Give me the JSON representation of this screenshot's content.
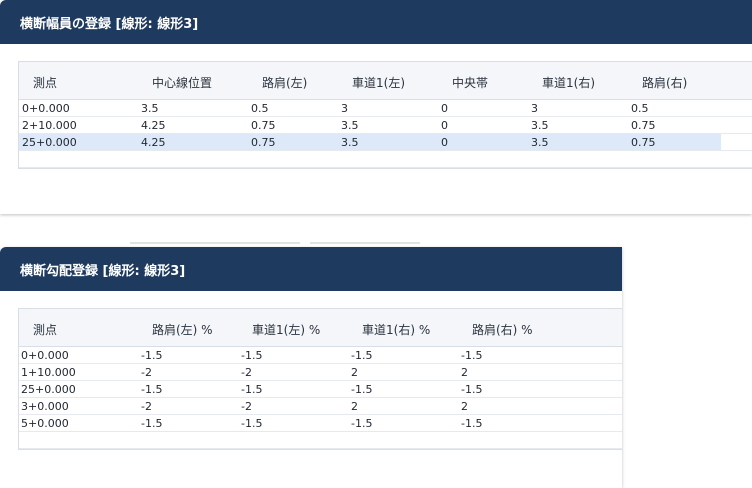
{
  "window1": {
    "title": "横断幅員の登録 [線形: 線形3]",
    "columns": [
      "測点",
      "中心線位置",
      "路肩(左)",
      "車道1(左)",
      "中央帯",
      "車道1(右)",
      "路肩(右)"
    ],
    "rows": [
      [
        "0+0.000",
        "3.5",
        "0.5",
        "3",
        "0",
        "3",
        "0.5"
      ],
      [
        "2+10.000",
        "4.25",
        "0.75",
        "3.5",
        "0",
        "3.5",
        "0.75"
      ],
      [
        "25+0.000",
        "4.25",
        "0.75",
        "3.5",
        "0",
        "3.5",
        "0.75"
      ]
    ],
    "selected_row": 2
  },
  "window2": {
    "title": "横断勾配登録 [線形: 線形3]",
    "columns": [
      "測点",
      "路肩(左) %",
      "車道1(左) %",
      "車道1(右) %",
      "路肩(右) %"
    ],
    "rows": [
      [
        "0+0.000",
        "-1.5",
        "-1.5",
        "-1.5",
        "-1.5"
      ],
      [
        "1+10.000",
        "-2",
        "-2",
        "2",
        "2"
      ],
      [
        "25+0.000",
        "-1.5",
        "-1.5",
        "-1.5",
        "-1.5"
      ],
      [
        "3+0.000",
        "-2",
        "-2",
        "2",
        "2"
      ],
      [
        "5+0.000",
        "-1.5",
        "-1.5",
        "-1.5",
        "-1.5"
      ]
    ]
  },
  "colors": {
    "titlebar": "#1f3a5f",
    "selected_row": "#dde9f8",
    "header_bg": "#f4f6f9"
  }
}
